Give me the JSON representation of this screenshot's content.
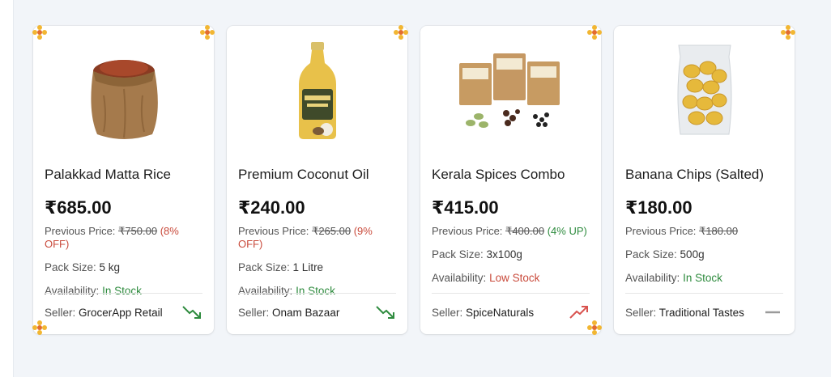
{
  "labels": {
    "previous_price": "Previous Price:",
    "pack_size": "Pack Size:",
    "availability": "Availability:",
    "seller": "Seller:"
  },
  "colors": {
    "down_trend": "#2e8b3e",
    "up_trend": "#d9534f",
    "neutral_trend": "#9a9a9a",
    "off_text": "#c94a3b",
    "up_text": "#2e8b3e",
    "in_stock": "#2e8b3e",
    "low_stock": "#c94a3b"
  },
  "products": [
    {
      "name": "Palakkad Matta Rice",
      "price": "₹685.00",
      "previous_price": "₹750.00",
      "change": "(8% OFF)",
      "change_type": "off",
      "pack_size": "5 kg",
      "availability": "In Stock",
      "availability_type": "in",
      "seller": "GrocerApp Retail",
      "trend": "down",
      "image_icon": "rice-sack-icon",
      "trend_icon": "trend-down-icon"
    },
    {
      "name": "Premium Coconut Oil",
      "price": "₹240.00",
      "previous_price": "₹265.00",
      "change": "(9% OFF)",
      "change_type": "off",
      "pack_size": "1 Litre",
      "availability": "In Stock",
      "availability_type": "in",
      "seller": "Onam Bazaar",
      "trend": "down",
      "image_icon": "oil-bottle-icon",
      "trend_icon": "trend-down-icon"
    },
    {
      "name": "Kerala Spices Combo",
      "price": "₹415.00",
      "previous_price": "₹400.00",
      "change": "(4% UP)",
      "change_type": "up",
      "pack_size": "3x100g",
      "availability": "Low Stock",
      "availability_type": "low",
      "seller": "SpiceNaturals",
      "trend": "up",
      "image_icon": "spice-packets-icon",
      "trend_icon": "trend-up-icon"
    },
    {
      "name": "Banana Chips (Salted)",
      "price": "₹180.00",
      "previous_price": "₹180.00",
      "change": "",
      "change_type": "none",
      "pack_size": "500g",
      "availability": "In Stock",
      "availability_type": "in",
      "seller": "Traditional Tastes",
      "trend": "flat",
      "image_icon": "chips-bag-icon",
      "trend_icon": "trend-flat-icon"
    }
  ]
}
